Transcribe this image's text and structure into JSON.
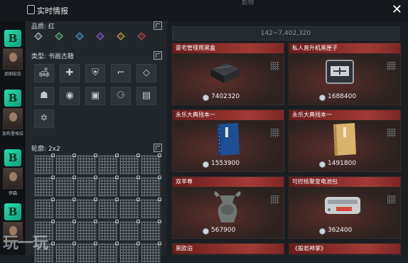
{
  "window": {
    "title": "实时情报",
    "top_faint": "影修",
    "close_symbol": "✕"
  },
  "characters": [
    {
      "badge": "B",
      "name": "武田宏志"
    },
    {
      "badge": "B",
      "name": "加布里埃拉"
    },
    {
      "badge": "B",
      "name": "伊森"
    },
    {
      "badge": "B",
      "name": ""
    }
  ],
  "filters": {
    "quality_label": "品质: 红",
    "quality_colors": [
      "#c9ced3",
      "#5fd08a",
      "#49a9e6",
      "#9b62d6",
      "#d8b241",
      "#d94848"
    ],
    "type_label": "类型: 书画古籍",
    "type_icons": [
      "sofa-icon",
      "medkit-icon",
      "vest-icon",
      "pistol-icon",
      "diamond-icon",
      "cap-icon",
      "camera-icon",
      "car-icon",
      "utensils-icon",
      "book-icon",
      "star-icon"
    ],
    "type_glyphs": [
      "🛋",
      "✚",
      "⛨",
      "⌐",
      "◇",
      "☗",
      "◉",
      "▣",
      "⚆",
      "▤",
      "✡"
    ],
    "shape_label": "轮廓: 2x2"
  },
  "results": {
    "range": "142~7,402,320",
    "items": [
      {
        "name": "豪宅管理用黑盒",
        "price": "7402320",
        "art": "black-box"
      },
      {
        "name": "私人直升机黑匣子",
        "price": "1688400",
        "art": "flight-recorder"
      },
      {
        "name": "永乐大典残本一",
        "price": "1553900",
        "art": "blue-book"
      },
      {
        "name": "永乐大典残本一",
        "price": "1491800",
        "art": "tan-book"
      },
      {
        "name": "双羊尊",
        "price": "567900",
        "art": "bronze-vessel"
      },
      {
        "name": "可控核聚变电池包",
        "price": "362400",
        "art": "battery-pack"
      },
      {
        "name": "黑欧泊",
        "price": "",
        "art": ""
      },
      {
        "name": "《般若神掌》",
        "price": "",
        "art": ""
      }
    ]
  },
  "watermark": "玩一玩"
}
